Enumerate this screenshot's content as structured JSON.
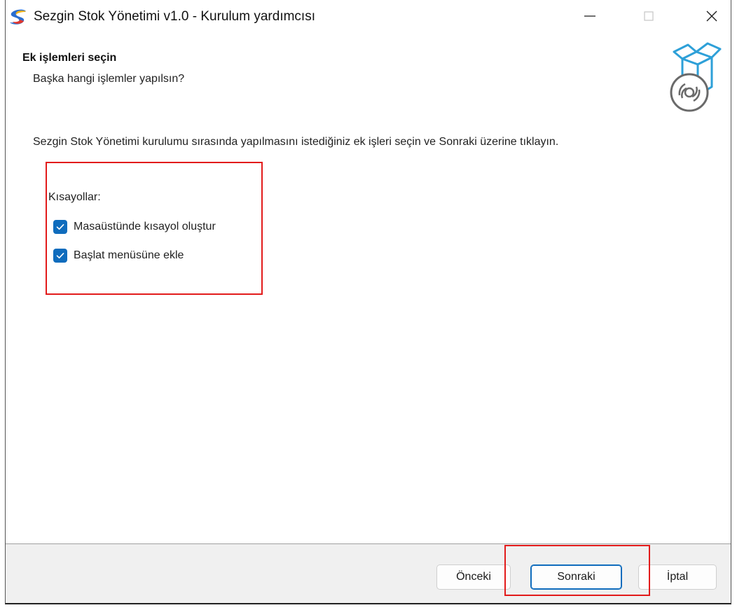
{
  "window": {
    "title": "Sezgin Stok Yönetimi v1.0 - Kurulum yardımcısı",
    "icon": "sezgin-logo-icon",
    "controls": [
      "minimize-icon",
      "maximize-icon",
      "close-icon"
    ]
  },
  "header": {
    "title": "Ek işlemleri seçin",
    "subtitle": "Başka hangi işlemler yapılsın?",
    "graphic": "setup-box-disc-icon"
  },
  "content": {
    "description": "Sezgin Stok Yönetimi kurulumu sırasında yapılmasını istediğiniz ek işleri seçin ve Sonraki üzerine tıklayın.",
    "section_label": "Kısayollar:",
    "tasks": [
      {
        "label": "Masaüstünde kısayol oluştur",
        "checked": true
      },
      {
        "label": "Başlat menüsüne ekle",
        "checked": true
      }
    ]
  },
  "footer": {
    "back_label": "Önceki",
    "next_label": "Sonraki",
    "cancel_label": "İptal"
  },
  "colors": {
    "accent": "#0f6cbd",
    "highlight": "#e21b1b",
    "footer_bg": "#f0f0f0"
  }
}
